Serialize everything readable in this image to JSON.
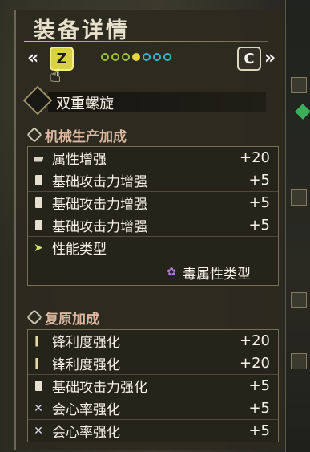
{
  "header": {
    "title": "装备详情"
  },
  "nav": {
    "prev_arrow": "«",
    "next_arrow": "»",
    "key_prev": "Z",
    "key_next": "C",
    "dots": [
      {
        "color": "#9fc23b",
        "active": false
      },
      {
        "color": "#9fc23b",
        "active": false
      },
      {
        "color": "#9fc23b",
        "active": false
      },
      {
        "color": "#e3d83a",
        "active": true
      },
      {
        "color": "#3ab6c9",
        "active": false
      },
      {
        "color": "#3ab6c9",
        "active": false
      },
      {
        "color": "#3ab6c9",
        "active": false
      }
    ]
  },
  "weapon": {
    "name": "双重螺旋",
    "icon": "weapon-icon"
  },
  "sections": [
    {
      "title": "机械生产加成",
      "rows": [
        {
          "icon": "ship-icon",
          "label": "属性增强",
          "value": "+20"
        },
        {
          "icon": "doc-icon",
          "label": "基础攻击力增强",
          "value": "+5"
        },
        {
          "icon": "doc-icon",
          "label": "基础攻击力增强",
          "value": "+5"
        },
        {
          "icon": "doc-icon",
          "label": "基础攻击力增强",
          "value": "+5"
        },
        {
          "icon": "arrow-icon",
          "label": "性能类型",
          "value": ""
        }
      ],
      "extra": {
        "icon": "poison-icon",
        "label": "毒属性类型"
      }
    },
    {
      "title": "复原加成",
      "rows": [
        {
          "icon": "blade-icon",
          "label": "锋利度强化",
          "value": "+20"
        },
        {
          "icon": "blade-icon",
          "label": "锋利度强化",
          "value": "+20"
        },
        {
          "icon": "doc-icon",
          "label": "基础攻击力强化",
          "value": "+5"
        },
        {
          "icon": "cross-icon",
          "label": "会心率强化",
          "value": "+5"
        },
        {
          "icon": "cross-icon",
          "label": "会心率强化",
          "value": "+5"
        }
      ]
    }
  ],
  "colors": {
    "accent_key": "#d8d240",
    "section_title": "#ddb8a0",
    "text": "#f4f1e6"
  }
}
